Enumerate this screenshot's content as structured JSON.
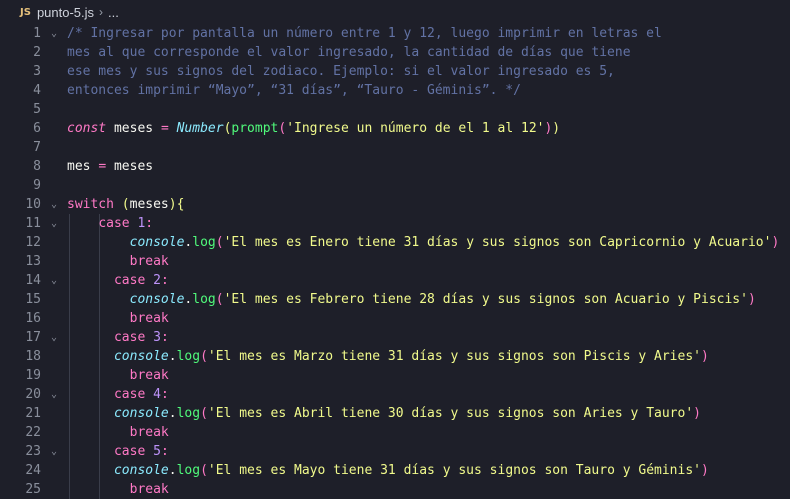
{
  "breadcrumb": {
    "badge": "JS",
    "filename": "punto-5.js",
    "separator": "›",
    "more": "..."
  },
  "lines": [
    {
      "n": "1",
      "fold": "⌄",
      "tokens": [
        {
          "c": "tk-comment",
          "t": "/* Ingresar por pantalla un número entre 1 y 12, luego imprimir en letras el"
        }
      ]
    },
    {
      "n": "2",
      "tokens": [
        {
          "c": "tk-comment",
          "t": "mes al que corresponde el valor ingresado, la cantidad de días que tiene"
        }
      ]
    },
    {
      "n": "3",
      "tokens": [
        {
          "c": "tk-comment",
          "t": "ese mes y sus signos del zodiaco. Ejemplo: si el valor ingresado es 5,"
        }
      ]
    },
    {
      "n": "4",
      "tokens": [
        {
          "c": "tk-comment",
          "t": "entonces imprimir “Mayo”, “31 días”, “Tauro - Géminis”. */"
        }
      ]
    },
    {
      "n": "5",
      "tokens": []
    },
    {
      "n": "6",
      "tokens": [
        {
          "c": "tk-kw tk-it",
          "t": "const"
        },
        {
          "c": "tk-var",
          "t": " meses "
        },
        {
          "c": "tk-op",
          "t": "="
        },
        {
          "c": "tk-var",
          "t": " "
        },
        {
          "c": "tk-cls",
          "t": "Number"
        },
        {
          "c": "tk-p1",
          "t": "("
        },
        {
          "c": "tk-fn",
          "t": "prompt"
        },
        {
          "c": "tk-p2",
          "t": "("
        },
        {
          "c": "tk-str",
          "t": "'Ingrese un número de el 1 al 12'"
        },
        {
          "c": "tk-p2",
          "t": ")"
        },
        {
          "c": "tk-p1",
          "t": ")"
        }
      ]
    },
    {
      "n": "7",
      "tokens": []
    },
    {
      "n": "8",
      "tokens": [
        {
          "c": "tk-var",
          "t": "mes "
        },
        {
          "c": "tk-op",
          "t": "="
        },
        {
          "c": "tk-var",
          "t": " meses"
        }
      ]
    },
    {
      "n": "9",
      "tokens": []
    },
    {
      "n": "10",
      "fold": "⌄",
      "tokens": [
        {
          "c": "tk-kw",
          "t": "switch"
        },
        {
          "c": "tk-var",
          "t": " "
        },
        {
          "c": "tk-p1",
          "t": "("
        },
        {
          "c": "tk-var",
          "t": "meses"
        },
        {
          "c": "tk-p1",
          "t": "){"
        }
      ]
    },
    {
      "n": "11",
      "fold": "⌄",
      "indent": "    ",
      "tokens": [
        {
          "c": "tk-kw",
          "t": "case"
        },
        {
          "c": "tk-var",
          "t": " "
        },
        {
          "c": "tk-num",
          "t": "1"
        },
        {
          "c": "tk-op",
          "t": ":"
        }
      ]
    },
    {
      "n": "12",
      "indent": "        ",
      "tokens": [
        {
          "c": "tk-cls",
          "t": "console"
        },
        {
          "c": "tk-punct",
          "t": "."
        },
        {
          "c": "tk-fn",
          "t": "log"
        },
        {
          "c": "tk-p2",
          "t": "("
        },
        {
          "c": "tk-str",
          "t": "'El mes es Enero tiene 31 días y sus signos son Capricornio y Acuario'"
        },
        {
          "c": "tk-p2",
          "t": ")"
        }
      ]
    },
    {
      "n": "13",
      "indent": "        ",
      "tokens": [
        {
          "c": "tk-kw",
          "t": "break"
        }
      ]
    },
    {
      "n": "14",
      "fold": "⌄",
      "indent": "      ",
      "tokens": [
        {
          "c": "tk-kw",
          "t": "case"
        },
        {
          "c": "tk-var",
          "t": " "
        },
        {
          "c": "tk-num",
          "t": "2"
        },
        {
          "c": "tk-op",
          "t": ":"
        }
      ]
    },
    {
      "n": "15",
      "indent": "        ",
      "tokens": [
        {
          "c": "tk-cls",
          "t": "console"
        },
        {
          "c": "tk-punct",
          "t": "."
        },
        {
          "c": "tk-fn",
          "t": "log"
        },
        {
          "c": "tk-p2",
          "t": "("
        },
        {
          "c": "tk-str",
          "t": "'El mes es Febrero tiene 28 días y sus signos son Acuario y Piscis'"
        },
        {
          "c": "tk-p2",
          "t": ")"
        }
      ]
    },
    {
      "n": "16",
      "indent": "        ",
      "tokens": [
        {
          "c": "tk-kw",
          "t": "break"
        }
      ]
    },
    {
      "n": "17",
      "fold": "⌄",
      "indent": "      ",
      "tokens": [
        {
          "c": "tk-kw",
          "t": "case"
        },
        {
          "c": "tk-var",
          "t": " "
        },
        {
          "c": "tk-num",
          "t": "3"
        },
        {
          "c": "tk-op",
          "t": ":"
        }
      ]
    },
    {
      "n": "18",
      "indent": "      ",
      "tokens": [
        {
          "c": "tk-cls",
          "t": "console"
        },
        {
          "c": "tk-punct",
          "t": "."
        },
        {
          "c": "tk-fn",
          "t": "log"
        },
        {
          "c": "tk-p2",
          "t": "("
        },
        {
          "c": "tk-str",
          "t": "'El mes es Marzo tiene 31 días y sus signos son Piscis y Aries'"
        },
        {
          "c": "tk-p2",
          "t": ")"
        }
      ]
    },
    {
      "n": "19",
      "indent": "        ",
      "tokens": [
        {
          "c": "tk-kw",
          "t": "break"
        }
      ]
    },
    {
      "n": "20",
      "fold": "⌄",
      "indent": "      ",
      "tokens": [
        {
          "c": "tk-kw",
          "t": "case"
        },
        {
          "c": "tk-var",
          "t": " "
        },
        {
          "c": "tk-num",
          "t": "4"
        },
        {
          "c": "tk-op",
          "t": ":"
        }
      ]
    },
    {
      "n": "21",
      "indent": "      ",
      "tokens": [
        {
          "c": "tk-cls",
          "t": "console"
        },
        {
          "c": "tk-punct",
          "t": "."
        },
        {
          "c": "tk-fn",
          "t": "log"
        },
        {
          "c": "tk-p2",
          "t": "("
        },
        {
          "c": "tk-str",
          "t": "'El mes es Abril tiene 30 días y sus signos son Aries y Tauro'"
        },
        {
          "c": "tk-p2",
          "t": ")"
        }
      ]
    },
    {
      "n": "22",
      "indent": "        ",
      "tokens": [
        {
          "c": "tk-kw",
          "t": "break"
        }
      ]
    },
    {
      "n": "23",
      "fold": "⌄",
      "indent": "      ",
      "tokens": [
        {
          "c": "tk-kw",
          "t": "case"
        },
        {
          "c": "tk-var",
          "t": " "
        },
        {
          "c": "tk-num",
          "t": "5"
        },
        {
          "c": "tk-op",
          "t": ":"
        }
      ]
    },
    {
      "n": "24",
      "indent": "      ",
      "tokens": [
        {
          "c": "tk-cls",
          "t": "console"
        },
        {
          "c": "tk-punct",
          "t": "."
        },
        {
          "c": "tk-fn",
          "t": "log"
        },
        {
          "c": "tk-p2",
          "t": "("
        },
        {
          "c": "tk-str",
          "t": "'El mes es Mayo tiene 31 días y sus signos son Tauro y Géminis'"
        },
        {
          "c": "tk-p2",
          "t": ")"
        }
      ]
    },
    {
      "n": "25",
      "indent": "        ",
      "tokens": [
        {
          "c": "tk-kw",
          "t": "break"
        }
      ]
    }
  ]
}
